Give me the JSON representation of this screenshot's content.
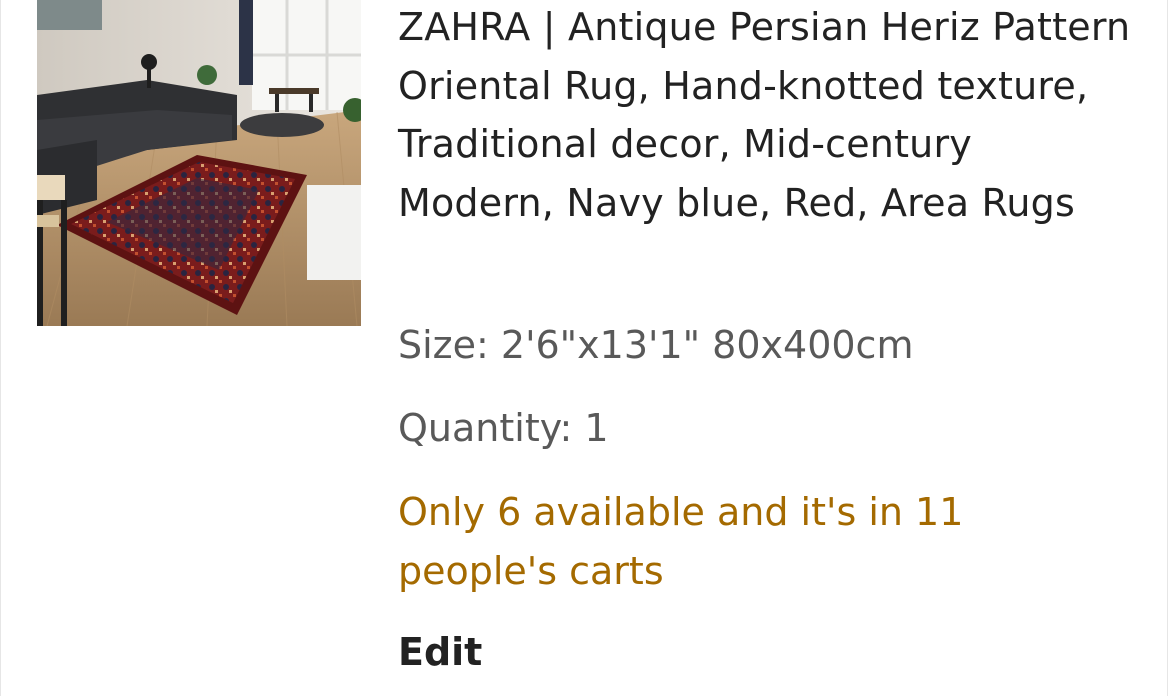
{
  "listing": {
    "image_alt": "Living room with sofa and red Persian rug",
    "title": "ZAHRA | Antique Persian Heriz Pattern Oriental Rug, Hand-knotted texture, Traditional decor, Mid-century Modern, Navy blue, Red, Area Rugs",
    "size_text": "Size: 2'6\"x13'1\" 80x400cm",
    "quantity_text": "Quantity: 1",
    "availability_text": "Only 6 available and it's in 11 people's carts",
    "edit_label": "Edit"
  },
  "colors": {
    "title": "#222222",
    "meta": "#595959",
    "availability": "#a46a00"
  }
}
